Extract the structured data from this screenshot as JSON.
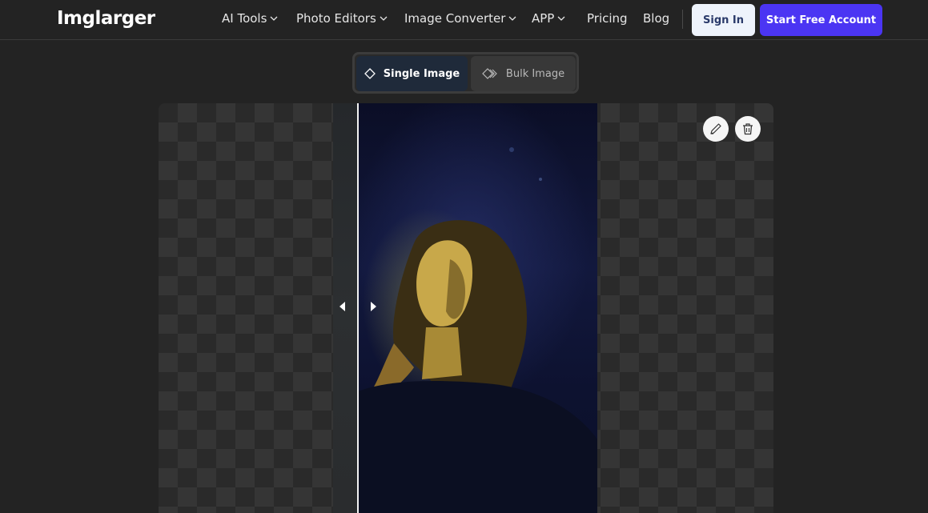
{
  "header": {
    "logo": "Imglarger",
    "nav": [
      {
        "label": "AI Tools",
        "has_dropdown": true
      },
      {
        "label": "Photo Editors",
        "has_dropdown": true
      },
      {
        "label": "Image Converter",
        "has_dropdown": true
      },
      {
        "label": "APP",
        "has_dropdown": true
      },
      {
        "label": "Pricing",
        "has_dropdown": false
      },
      {
        "label": "Blog",
        "has_dropdown": false
      }
    ],
    "sign_in_label": "Sign In",
    "start_label": "Start Free Account"
  },
  "mode_toggle": {
    "single_label": "Single Image",
    "bulk_label": "Bulk Image",
    "selected": "single"
  },
  "editor": {
    "tools": [
      "pencil-icon",
      "trash-icon"
    ],
    "compare_handle_icons": [
      "arrow-left-icon",
      "arrow-right-icon"
    ]
  },
  "colors": {
    "background": "#232323",
    "accent": "#4b35f3",
    "sign_in_bg": "#eef3fb"
  }
}
